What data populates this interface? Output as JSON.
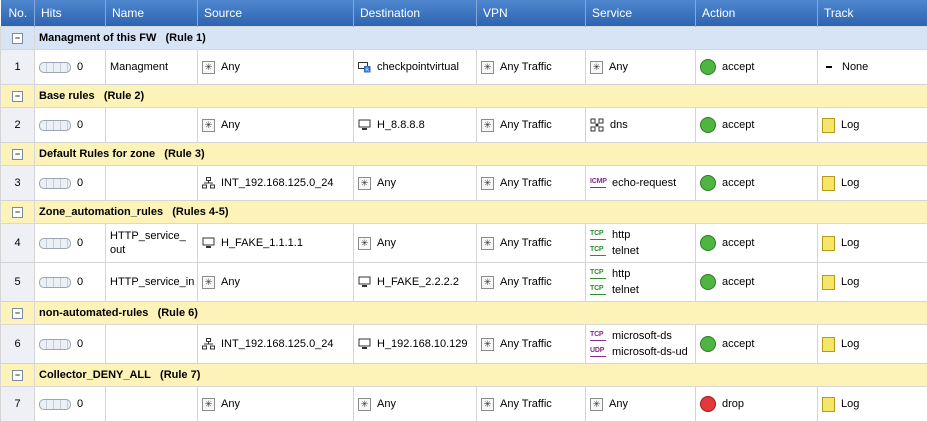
{
  "columns": [
    "No.",
    "Hits",
    "Name",
    "Source",
    "Destination",
    "VPN",
    "Service",
    "Action",
    "Track"
  ],
  "sections": [
    {
      "title": "Managment of this FW",
      "rule_ref": "(Rule 1)",
      "style": "mgmt",
      "rules": [
        {
          "no": "1",
          "hits": "0",
          "name": "Managment",
          "source": {
            "icon": "any",
            "text": "Any"
          },
          "destination": {
            "icon": "gateway",
            "text": "checkpointvirtual"
          },
          "vpn": {
            "icon": "any",
            "text": "Any Traffic"
          },
          "service": [
            {
              "icon": "any",
              "text": "Any"
            }
          ],
          "action": {
            "icon": "accept",
            "text": "accept"
          },
          "track": {
            "icon": "none",
            "text": "None"
          }
        }
      ]
    },
    {
      "title": "Base rules",
      "rule_ref": "(Rule 2)",
      "style": "yel",
      "rules": [
        {
          "no": "2",
          "hits": "0",
          "name": "",
          "source": {
            "icon": "any",
            "text": "Any"
          },
          "destination": {
            "icon": "host",
            "text": "H_8.8.8.8"
          },
          "vpn": {
            "icon": "any",
            "text": "Any Traffic"
          },
          "service": [
            {
              "icon": "dns",
              "text": "dns"
            }
          ],
          "action": {
            "icon": "accept",
            "text": "accept"
          },
          "track": {
            "icon": "log",
            "text": "Log"
          }
        }
      ]
    },
    {
      "title": "Default Rules for zone",
      "rule_ref": "(Rule 3)",
      "style": "yel",
      "rules": [
        {
          "no": "3",
          "hits": "0",
          "name": "",
          "source": {
            "icon": "network",
            "text": "INT_192.168.125.0_24"
          },
          "destination": {
            "icon": "any",
            "text": "Any"
          },
          "vpn": {
            "icon": "any",
            "text": "Any Traffic"
          },
          "service": [
            {
              "icon": "ICMP",
              "text": "echo-request"
            }
          ],
          "action": {
            "icon": "accept",
            "text": "accept"
          },
          "track": {
            "icon": "log",
            "text": "Log"
          }
        }
      ]
    },
    {
      "title": "Zone_automation_rules",
      "rule_ref": "(Rules 4-5)",
      "style": "yel",
      "rules": [
        {
          "no": "4",
          "hits": "0",
          "name": "HTTP_service_ out",
          "source": {
            "icon": "host",
            "text": "H_FAKE_1.1.1.1"
          },
          "destination": {
            "icon": "any",
            "text": "Any"
          },
          "vpn": {
            "icon": "any",
            "text": "Any Traffic"
          },
          "service": [
            {
              "icon": "TCP",
              "text": "http"
            },
            {
              "icon": "TCP",
              "text": "telnet"
            }
          ],
          "action": {
            "icon": "accept",
            "text": "accept"
          },
          "track": {
            "icon": "log",
            "text": "Log"
          }
        },
        {
          "no": "5",
          "hits": "0",
          "name": "HTTP_service_in",
          "source": {
            "icon": "any",
            "text": "Any"
          },
          "destination": {
            "icon": "host",
            "text": "H_FAKE_2.2.2.2"
          },
          "vpn": {
            "icon": "any",
            "text": "Any Traffic"
          },
          "service": [
            {
              "icon": "TCP",
              "text": "http"
            },
            {
              "icon": "TCP",
              "text": "telnet"
            }
          ],
          "action": {
            "icon": "accept",
            "text": "accept"
          },
          "track": {
            "icon": "log",
            "text": "Log"
          }
        }
      ]
    },
    {
      "title": "non-automated-rules",
      "rule_ref": "(Rule 6)",
      "style": "yel",
      "rules": [
        {
          "no": "6",
          "hits": "0",
          "name": "",
          "source": {
            "icon": "network",
            "text": "INT_192.168.125.0_24"
          },
          "destination": {
            "icon": "host",
            "text": "H_192.168.10.129"
          },
          "vpn": {
            "icon": "any",
            "text": "Any Traffic"
          },
          "service": [
            {
              "icon": "TCP-purple",
              "text": "microsoft-ds"
            },
            {
              "icon": "UDP",
              "text": "microsoft-ds-ud"
            }
          ],
          "action": {
            "icon": "accept",
            "text": "accept"
          },
          "track": {
            "icon": "log",
            "text": "Log"
          }
        }
      ]
    },
    {
      "title": "Collector_DENY_ALL",
      "rule_ref": "(Rule 7)",
      "style": "yel",
      "rules": [
        {
          "no": "7",
          "hits": "0",
          "name": "",
          "source": {
            "icon": "any",
            "text": "Any"
          },
          "destination": {
            "icon": "any",
            "text": "Any"
          },
          "vpn": {
            "icon": "any",
            "text": "Any Traffic"
          },
          "service": [
            {
              "icon": "any",
              "text": "Any"
            }
          ],
          "action": {
            "icon": "drop",
            "text": "drop"
          },
          "track": {
            "icon": "log",
            "text": "Log"
          }
        }
      ]
    }
  ],
  "colors": {
    "header": "#3a70bd",
    "section_mgmt": "#d6e4f6",
    "section_yellow": "#fdf3b8",
    "accept": "#4fb541",
    "drop": "#e23a3a"
  }
}
